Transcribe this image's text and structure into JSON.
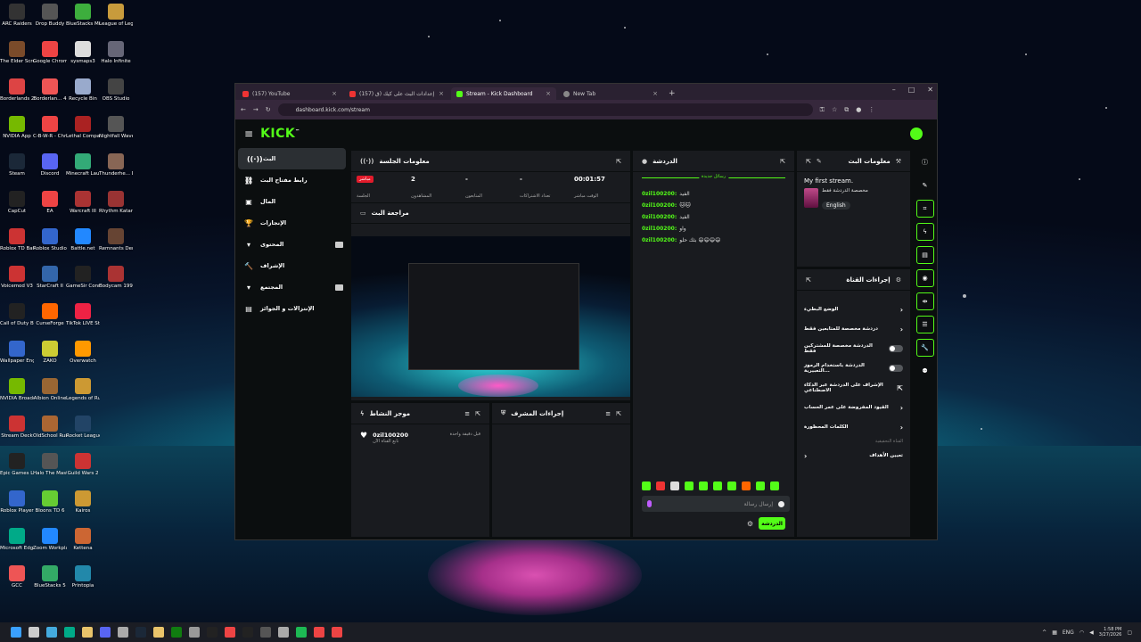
{
  "desktop": {
    "icons": [
      {
        "label": "ARC Raiders",
        "color": "#333"
      },
      {
        "label": "Drop Buddy",
        "color": "#555"
      },
      {
        "label": "BlueStacks Multi-Insta...",
        "color": "#3dae3d"
      },
      {
        "label": "League of Legends",
        "color": "#c89b3c"
      },
      {
        "label": "The Elder Scrolls IV...",
        "color": "#7a4b2a"
      },
      {
        "label": "Google Chrome",
        "color": "#e44"
      },
      {
        "label": "sysmaps3",
        "color": "#ddd"
      },
      {
        "label": "Halo Infinite",
        "color": "#667"
      },
      {
        "label": "Borderlands 2",
        "color": "#d44"
      },
      {
        "label": "Borderlan... 4",
        "color": "#e55"
      },
      {
        "label": "Recycle Bin",
        "color": "#9ac"
      },
      {
        "label": "OBS Studio",
        "color": "#444"
      },
      {
        "label": "NVIDIA App",
        "color": "#76b900"
      },
      {
        "label": "C-B-W-R - Chrome",
        "color": "#e44"
      },
      {
        "label": "Lethal Company",
        "color": "#a22"
      },
      {
        "label": "Nightfall Waves Demo",
        "color": "#555"
      },
      {
        "label": "Steam",
        "color": "#1b2838"
      },
      {
        "label": "Discord",
        "color": "#5865f2"
      },
      {
        "label": "Minecraft Launcher",
        "color": "#3a7"
      },
      {
        "label": "Thunderhe... Danger Cl...",
        "color": "#865"
      },
      {
        "label": "CapCut",
        "color": "#222"
      },
      {
        "label": "EA",
        "color": "#e44"
      },
      {
        "label": "Warcraft III",
        "color": "#a33"
      },
      {
        "label": "Rhythm Katana Demo",
        "color": "#933"
      },
      {
        "label": "Roblox TD Battles 2",
        "color": "#c33"
      },
      {
        "label": "Roblox Studio",
        "color": "#36c"
      },
      {
        "label": "Battle.net",
        "color": "#28f"
      },
      {
        "label": "Remnants Demo",
        "color": "#643"
      },
      {
        "label": "Voicemod V3",
        "color": "#c33"
      },
      {
        "label": "StarCraft II",
        "color": "#36a"
      },
      {
        "label": "GameSir Connect",
        "color": "#222"
      },
      {
        "label": "Bodycam 1997 Demo",
        "color": "#a33"
      },
      {
        "label": "Call of Duty Bl...",
        "color": "#222"
      },
      {
        "label": "CurseForge",
        "color": "#f60"
      },
      {
        "label": "TikTok LIVE Studio",
        "color": "#e24"
      },
      {
        "label": "",
        "color": "transparent"
      },
      {
        "label": "Wallpaper Engine",
        "color": "#36c"
      },
      {
        "label": "ZAKO",
        "color": "#cc3"
      },
      {
        "label": "Overwatch",
        "color": "#f90"
      },
      {
        "label": "",
        "color": "transparent"
      },
      {
        "label": "NVIDIA Broadcast",
        "color": "#76b900"
      },
      {
        "label": "Albion Online",
        "color": "#963"
      },
      {
        "label": "Legends of Runeterra",
        "color": "#c93"
      },
      {
        "label": "",
        "color": "transparent"
      },
      {
        "label": "Stream Deck",
        "color": "#c33"
      },
      {
        "label": "OldSchool RuneS...",
        "color": "#a63"
      },
      {
        "label": "Rocket League",
        "color": "#246"
      },
      {
        "label": "",
        "color": "transparent"
      },
      {
        "label": "Epic Games Launcher",
        "color": "#222"
      },
      {
        "label": "Halo The Master Ch...",
        "color": "#555"
      },
      {
        "label": "Guild Wars 2",
        "color": "#c33"
      },
      {
        "label": "",
        "color": "transparent"
      },
      {
        "label": "Roblox Player",
        "color": "#36c"
      },
      {
        "label": "Bloons TD 6",
        "color": "#6c3"
      },
      {
        "label": "Kairos",
        "color": "#c93"
      },
      {
        "label": "",
        "color": "transparent"
      },
      {
        "label": "Microsoft Edge",
        "color": "#0a8"
      },
      {
        "label": "Zoom Workplace",
        "color": "#28f"
      },
      {
        "label": "Kettena",
        "color": "#c63"
      },
      {
        "label": "",
        "color": "transparent"
      },
      {
        "label": "GCC",
        "color": "#e55"
      },
      {
        "label": "BlueStacks 5",
        "color": "#3a6"
      },
      {
        "label": "Printopia",
        "color": "#28a"
      },
      {
        "label": "",
        "color": "transparent"
      }
    ]
  },
  "taskbar": {
    "icons": [
      "windows-start",
      "search",
      "copilot",
      "edge",
      "explorer",
      "discord",
      "settings",
      "steam",
      "folder",
      "xbox",
      "gear",
      "tiktok",
      "chrome",
      "capcut",
      "terminal",
      "edit",
      "spotify",
      "chrome-alt",
      "stream"
    ],
    "lang": "ENG",
    "time": "1:58 PM",
    "date": "3/27/2026"
  },
  "browser": {
    "tabs": [
      {
        "title": "(157) YouTube",
        "color": "#e33",
        "active": false
      },
      {
        "title": "(157) إعدادات البث على كيك (ق",
        "color": "#e33",
        "active": false
      },
      {
        "title": "Stream - Kick Dashboard",
        "color": "#53fc18",
        "active": true
      },
      {
        "title": "New Tab",
        "color": "#888",
        "active": false
      }
    ],
    "url": "dashboard.kick.com/stream"
  },
  "kick": {
    "logo": "KICK",
    "sidebar": [
      {
        "label": "البث",
        "icon": "((·))",
        "active": true
      },
      {
        "label": "رابط مفتاح البث",
        "icon": "⛓"
      },
      {
        "label": "المال",
        "icon": "▣"
      },
      {
        "label": "الإنجازات",
        "icon": "🏆"
      },
      {
        "label": "المحتوى",
        "icon": "▾",
        "badge": true
      },
      {
        "label": "الإشراف",
        "icon": "🔨"
      },
      {
        "label": "المجتمع",
        "icon": "▾",
        "badge": true
      },
      {
        "label": "الإنتزالات و الجوائز",
        "icon": "▤"
      }
    ],
    "session": {
      "title": "معلومات الجلسة",
      "live": "مباشر",
      "live_label": "الجلسة",
      "stats": [
        {
          "value": "2",
          "label": "المشاهدون"
        },
        {
          "value": "-",
          "label": "المتابعون"
        },
        {
          "value": "-",
          "label": "تعداد الاشتراكات"
        },
        {
          "value": "00:01:57",
          "label": "الوقت مباشر"
        }
      ]
    },
    "preview_title": "مراجعة البث",
    "activity": {
      "title": "موجز النشاط",
      "item_name": "0zil100200",
      "item_sub": "تابع القناة الآن",
      "item_time": "قبل دقيقة واحدة"
    },
    "mod_title": "إجراءات المشرف",
    "chat": {
      "title": "الدردشة",
      "new_messages": "رسائل جديدة",
      "messages": [
        {
          "user": "0zil100200:",
          "text": "الفيد"
        },
        {
          "user": "0zil100200:",
          "text": "🐱🐱"
        },
        {
          "user": "0zil100200:",
          "text": "الفيد"
        },
        {
          "user": "0zil100200:",
          "text": "واو"
        },
        {
          "user": "0zil100200:",
          "text": "بثك حلو 😄😄😄😄"
        }
      ],
      "placeholder": "إرسال رسالة",
      "send": "الدردشة"
    },
    "stream_info": {
      "title": "معلومات البث",
      "stream_title": "My first stream.",
      "category": "مخصصة الدردشة فقط",
      "language": "English"
    },
    "channel_actions": {
      "title": "إجراءات القناة",
      "rows": [
        {
          "label": "الوضع البطيء",
          "type": "chevron"
        },
        {
          "label": "دردشة مخصصة للمتابعين فقط",
          "type": "chevron"
        },
        {
          "label": "الدردشة مخصصة للمشتركين فقط",
          "type": "toggle"
        },
        {
          "label": "الدردشة باستخدام الرموز التعبيرية...",
          "type": "toggle"
        },
        {
          "label": "الإشراف على الدردشة عبر الذكاء الاصطناعي",
          "type": "link"
        },
        {
          "label": "القيود المفروضة على عمر الحساب",
          "type": "chevron"
        },
        {
          "label": "الكلمات المحظورة",
          "type": "chevron"
        }
      ],
      "sub_label": "القناة التحقيقية",
      "goal_label": "تعيين الأهداف"
    }
  }
}
